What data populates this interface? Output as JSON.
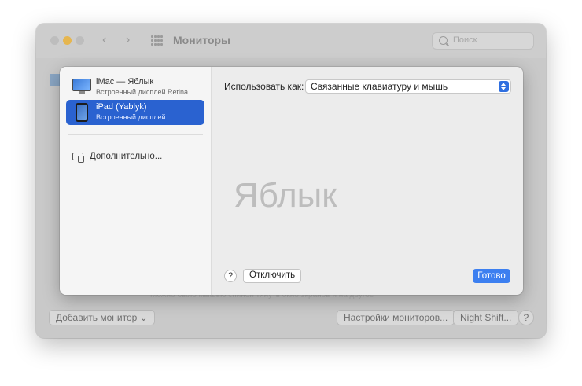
{
  "window": {
    "title": "Мониторы",
    "search_placeholder": "Поиск",
    "nav_back": "‹",
    "nav_forward": "›"
  },
  "background": {
    "faint_text": "Можно было мышью спиной тянуть окно экранов и на другое",
    "add_monitor": "Добавить монитор ⌄",
    "monitor_settings": "Настройки мониторов...",
    "night_shift": "Night Shift...",
    "help": "?"
  },
  "sidebar": {
    "devices": [
      {
        "name": "iMac — Яблык",
        "subtitle": "Встроенный дисплей Retina",
        "icon": "imac-icon"
      },
      {
        "name": "iPad (Yablyk)",
        "subtitle": "Встроенный дисплей",
        "icon": "ipad-icon"
      }
    ],
    "advanced_label": "Дополнительно..."
  },
  "content": {
    "use_as_label": "Использовать как:",
    "use_as_value": "Связанные клавиатуру и мышь",
    "watermark": "Яблык"
  },
  "footer": {
    "help": "?",
    "disconnect": "Отключить",
    "done": "Готово"
  },
  "colors": {
    "accent": "#2a62d0",
    "done_button": "#3c7ff0",
    "traffic_minimize": "#e6b64f"
  }
}
